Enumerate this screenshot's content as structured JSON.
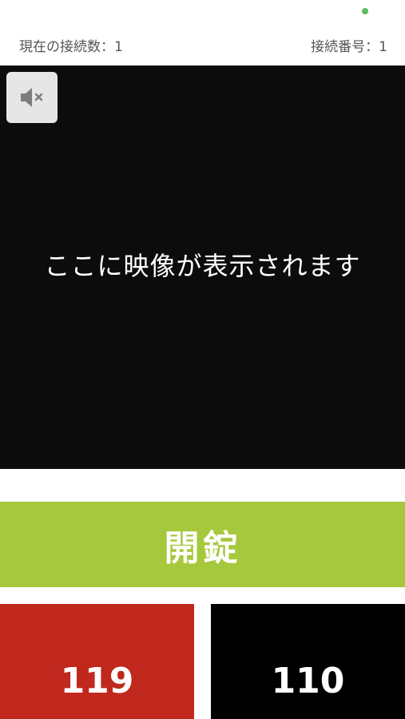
{
  "colors": {
    "status_dot": "#5cbd5c",
    "video_background": "#0c0c0c",
    "unlock": "#a6c83d",
    "fire_ambulance": "#c0281e",
    "police": "#000000"
  },
  "status": {
    "current_connections_label": "現在の接続数：1",
    "connection_number_label": "接続番号：1"
  },
  "video": {
    "placeholder": "ここに映像が表示されます",
    "mute_icon": "speaker-muted-icon"
  },
  "actions": {
    "unlock_label": "開錠",
    "emergency_119_label": "119",
    "emergency_110_label": "110"
  }
}
